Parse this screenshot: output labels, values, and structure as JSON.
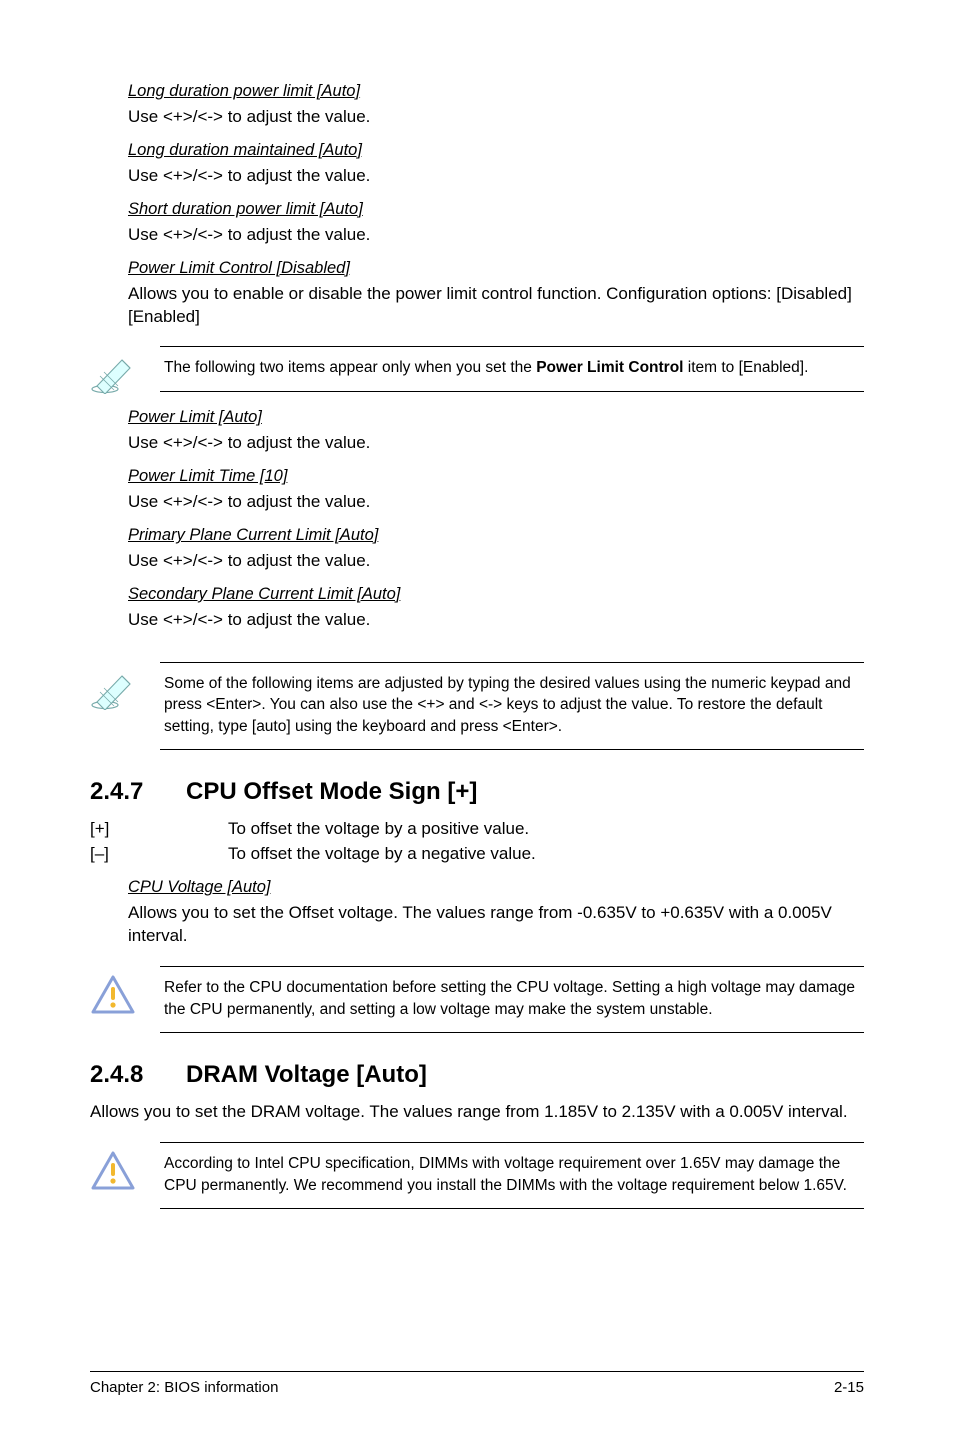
{
  "block1": {
    "items": [
      {
        "title": "Long duration power limit [Auto]",
        "body": "Use <+>/<-> to adjust the value."
      },
      {
        "title": "Long duration maintained [Auto]",
        "body": "Use <+>/<-> to adjust the value."
      },
      {
        "title": "Short duration power limit [Auto]",
        "body": "Use <+>/<-> to adjust the value."
      },
      {
        "title": "Power Limit Control [Disabled]",
        "body": "Allows you to enable or disable the power limit control function. Configuration options: [Disabled] [Enabled]"
      }
    ]
  },
  "note1": {
    "prefix": "The following two items appear only when you set the ",
    "bold": "Power Limit Control",
    "suffix": " item to [Enabled]."
  },
  "block2": {
    "items": [
      {
        "title": "Power Limit [Auto]",
        "body": "Use <+>/<-> to adjust the value."
      },
      {
        "title": "Power Limit Time [10]",
        "body": "Use <+>/<-> to adjust the value."
      },
      {
        "title": "Primary Plane Current Limit [Auto]",
        "body": "Use <+>/<-> to adjust the value."
      },
      {
        "title": "Secondary Plane Current Limit [Auto]",
        "body": "Use <+>/<-> to adjust the value."
      }
    ]
  },
  "note2": "Some of the following items are adjusted by typing the desired values using the numeric keypad and press <Enter>. You can also use the <+> and <-> keys to adjust the value. To restore the default setting, type [auto] using the keyboard and press <Enter>.",
  "section247": {
    "num": "2.4.7",
    "title": "CPU Offset Mode Sign [+]",
    "rows": [
      {
        "k": "[+]",
        "v": "To offset the voltage by a positive value."
      },
      {
        "k": "[–]",
        "v": "To offset the voltage by a negative value."
      }
    ],
    "cv": {
      "title": "CPU Voltage [Auto]",
      "body": "Allows you to set the Offset voltage. The values range from -0.635V to +0.635V with a 0.005V interval."
    }
  },
  "note3": "Refer to the CPU documentation before setting the CPU voltage. Setting a high voltage may damage the CPU permanently, and setting a low voltage may make the system unstable.",
  "section248": {
    "num": "2.4.8",
    "title": "DRAM Voltage [Auto]",
    "body": "Allows you to set the DRAM voltage. The values range from 1.185V to 2.135V with a 0.005V interval."
  },
  "note4": "According to Intel CPU specification, DIMMs with voltage requirement over 1.65V may damage the CPU permanently. We recommend you install the DIMMs with the voltage requirement below 1.65V.",
  "footer": {
    "left": "Chapter 2: BIOS information",
    "right": "2-15"
  }
}
